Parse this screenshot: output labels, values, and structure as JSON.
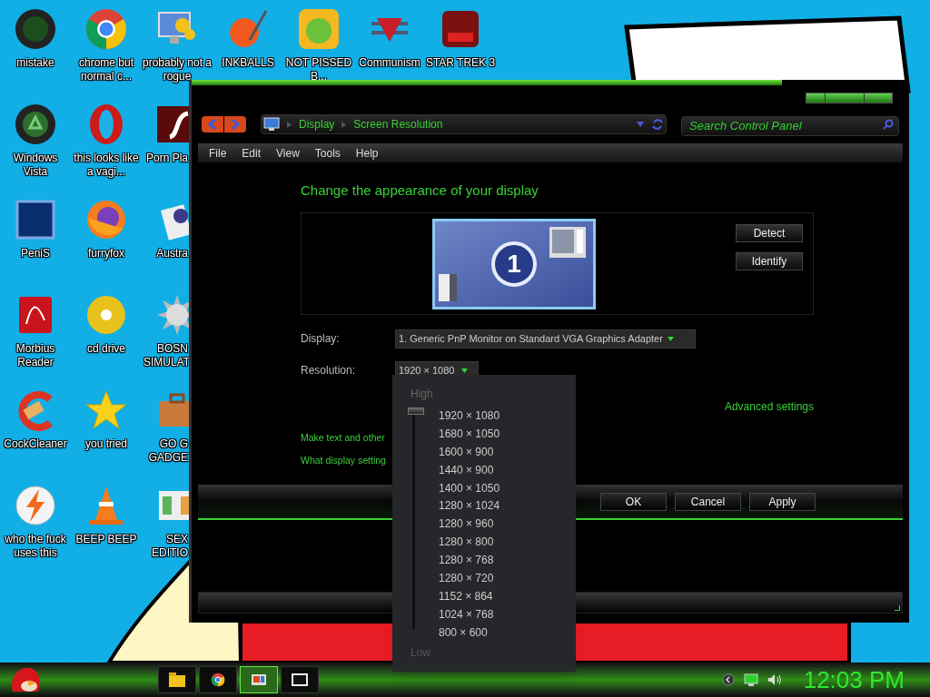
{
  "desktop": {
    "columns": [
      {
        "icons": [
          "mistake",
          "Windows Vista",
          "PeniS",
          "Morbius Reader",
          "CockCleaner",
          "who the fuck uses this"
        ]
      },
      {
        "icons": [
          "chrome but normal c...",
          "this looks like a vagi...",
          "furryfox",
          "cd drive",
          "you tried",
          "BEEP BEEP"
        ]
      },
      {
        "icons": [
          "probably not a rogue",
          "Porn Pla",
          "Austra",
          "BOSN SIMULAT",
          "GO G GADGE",
          "SEX EDITIO"
        ]
      },
      {
        "icons": [
          "INKBALLS"
        ]
      },
      {
        "icons": [
          "NOT PISSED B..."
        ]
      },
      {
        "icons": [
          "Communism"
        ]
      },
      {
        "icons": [
          "STAR TREK 3"
        ]
      }
    ]
  },
  "window": {
    "breadcrumb": [
      "Display",
      "Screen Resolution"
    ],
    "search": {
      "placeholder": "Search Control Panel"
    },
    "menu": [
      "File",
      "Edit",
      "View",
      "Tools",
      "Help"
    ],
    "heading": "Change the appearance of your display",
    "monitor_number": "1",
    "side_buttons": [
      "Detect",
      "Identify"
    ],
    "display": {
      "label": "Display:",
      "value": "1. Generic PnP Monitor on Standard VGA Graphics Adapter"
    },
    "resolution": {
      "label": "Resolution:",
      "value": "1920 × 1080",
      "popup": {
        "high": "High",
        "low": "Low",
        "level": 1,
        "options": [
          "1920 × 1080",
          "1680 × 1050",
          "1600 × 900",
          "1440 × 900",
          "1400 × 1050",
          "1280 × 1024",
          "1280 × 960",
          "1280 × 800",
          "1280 × 768",
          "1280 × 720",
          "1152 × 864",
          "1024 × 768",
          "800 × 600"
        ]
      }
    },
    "advanced_link": "Advanced settings",
    "links": [
      "Make text and other",
      "What display setting"
    ],
    "buttons": [
      "OK",
      "Cancel",
      "Apply"
    ]
  },
  "taskbar": {
    "buttons": [
      {
        "selected": false
      },
      {
        "selected": false
      },
      {
        "selected": true
      },
      {
        "selected": false
      }
    ],
    "clock": "12:03 PM"
  }
}
